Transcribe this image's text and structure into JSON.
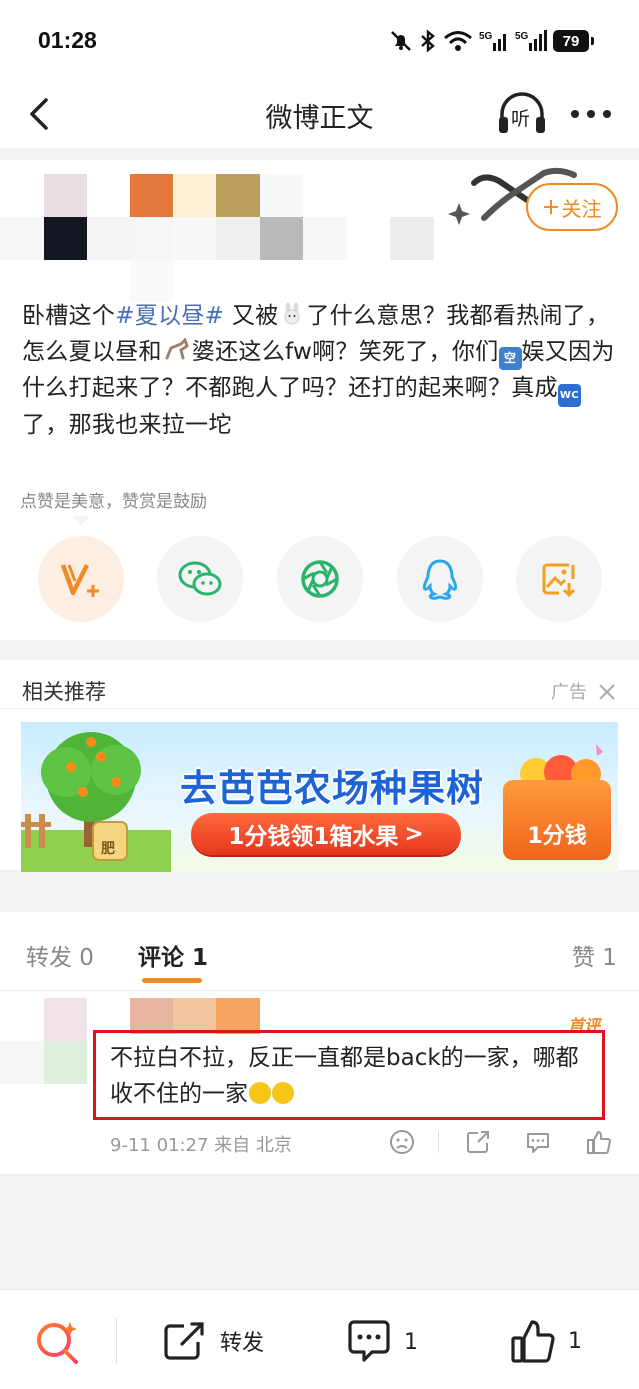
{
  "status_bar": {
    "time": "01:28",
    "battery": "79",
    "network": "5G"
  },
  "nav": {
    "title": "微博正文",
    "listen_label": "听"
  },
  "post": {
    "follow_label": "关注",
    "text_parts": {
      "p1": "卧槽这个",
      "topic": "#夏以昼#",
      "p2": " 又被",
      "p3": "了什么意思？我都看热闹了，怎么夏以昼和",
      "p4": "婆还这么fw啊？笑死了，你们",
      "kong_emoji": "空",
      "p5": "娱又因为什么打起来了？不都跑人了吗？还打的起来啊？真成",
      "wc_emoji": "WC",
      "p6": "了，那我也来拉一坨"
    },
    "reward_tip": "点赞是美意，赞赏是鼓励"
  },
  "recommend": {
    "title": "相关推荐",
    "ad_tag": "广告",
    "ad": {
      "headline": "去芭芭农场种果树",
      "cta": "1分钱领1箱水果",
      "cta_arrow": ">",
      "box_label": "1分钱",
      "jar_label": "肥"
    }
  },
  "tabs": {
    "repost": "转发 0",
    "comments": "评论 1",
    "likes": "赞 1"
  },
  "comment": {
    "badge": "首评",
    "text": "不拉白不拉，反正一直都是back的一家，哪都收不住的一家",
    "meta": "9-11 01:27  来自 北京"
  },
  "bottom_bar": {
    "repost_label": "转发",
    "comment_count": "1",
    "like_count": "1"
  },
  "colors": {
    "accent": "#f08a24",
    "topic_link": "#4a6fb5",
    "highlight": "#e0121c",
    "wechat": "#2ab36b",
    "moments": "#2ab36b",
    "qq": "#2aa8e8",
    "save": "#f0a020"
  }
}
